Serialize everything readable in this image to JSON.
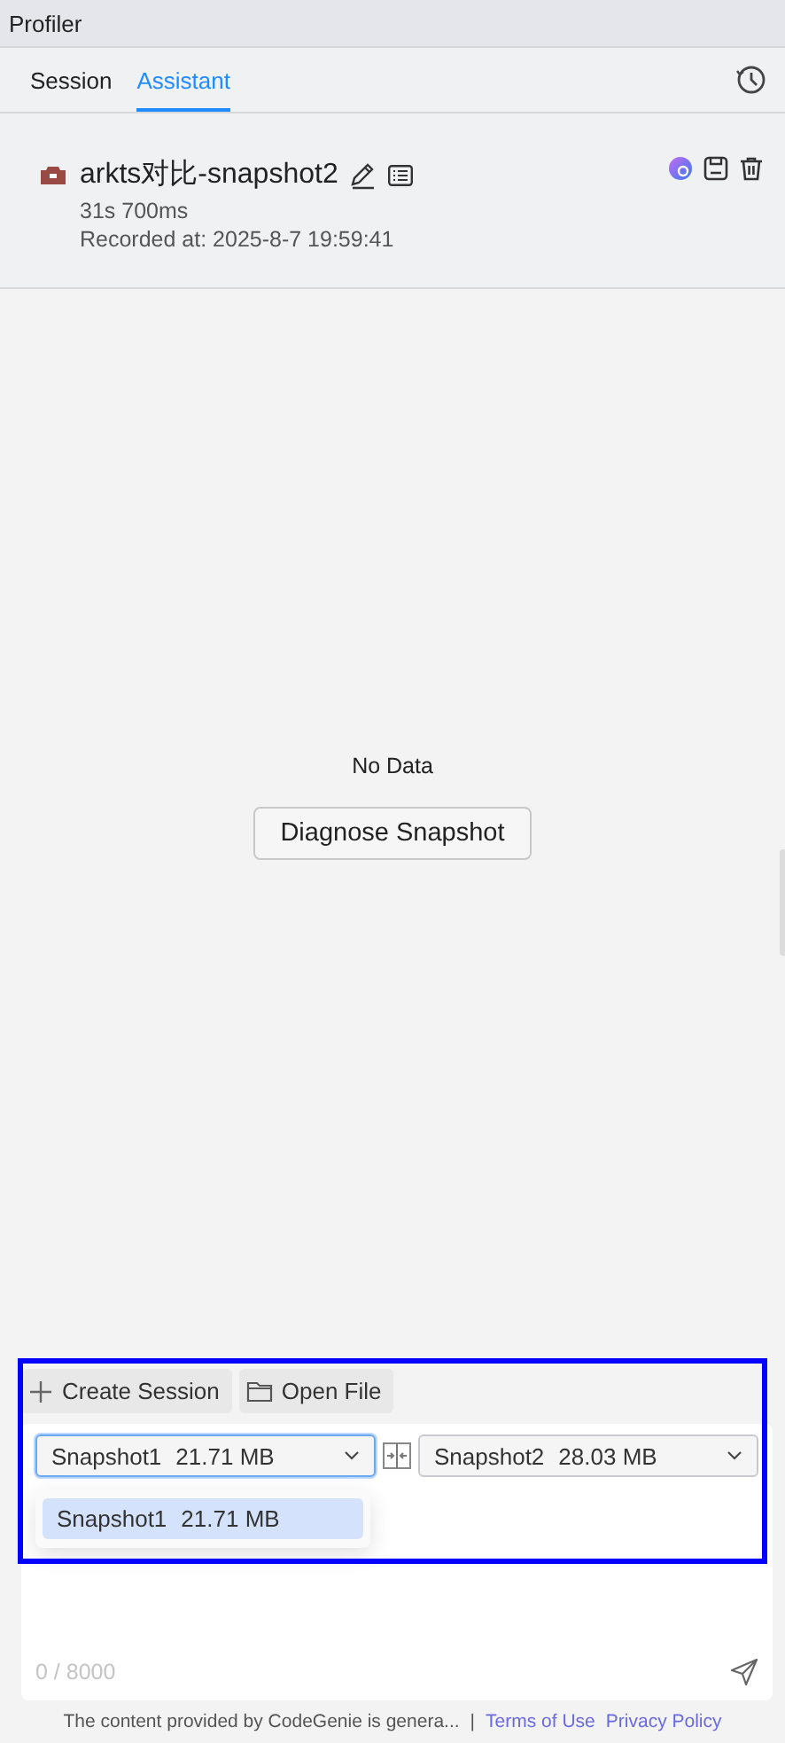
{
  "window": {
    "title": "Profiler"
  },
  "tabs": [
    {
      "label": "Session",
      "selected": false
    },
    {
      "label": "Assistant",
      "selected": true
    }
  ],
  "snapshot": {
    "name": "arkts对比-snapshot2",
    "duration": "31s 700ms",
    "recorded": "Recorded at: 2025-8-7 19:59:41"
  },
  "empty_state": {
    "message": "No Data",
    "button": "Diagnose Snapshot"
  },
  "toolbar": [
    {
      "kind": "create",
      "label": "Create Session"
    },
    {
      "kind": "open",
      "label": "Open File"
    }
  ],
  "compare": [
    {
      "label": "Snapshot1",
      "size": "21.71 MB",
      "focused": true
    },
    {
      "label": "Snapshot2",
      "size": "28.03 MB",
      "focused": false
    }
  ],
  "dropdown": {
    "options": [
      {
        "label": "Snapshot1",
        "size": "21.71 MB",
        "selected": true
      }
    ]
  },
  "input": {
    "counter": "0 / 8000"
  },
  "footer": {
    "notice": "The content provided by CodeGenie is genera...",
    "separator": "|",
    "links": [
      "Terms of Use",
      "Privacy Policy"
    ]
  }
}
